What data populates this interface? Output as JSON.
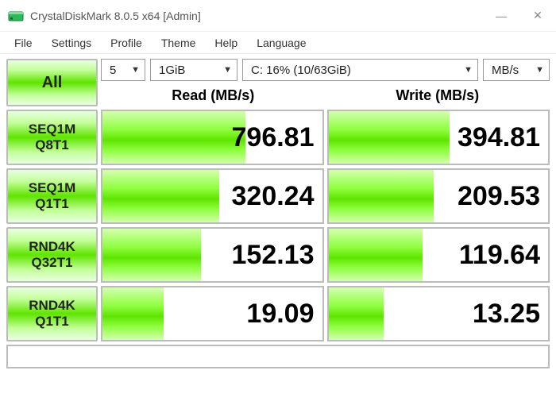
{
  "window": {
    "title": "CrystalDiskMark 8.0.5 x64 [Admin]",
    "minimize": "—",
    "close": "✕"
  },
  "menu": {
    "file": "File",
    "settings": "Settings",
    "profile": "Profile",
    "theme": "Theme",
    "help": "Help",
    "language": "Language"
  },
  "controls": {
    "all_label": "All",
    "runs": "5",
    "size": "1GiB",
    "drive": "C: 16% (10/63GiB)",
    "unit": "MB/s"
  },
  "headers": {
    "read": "Read (MB/s)",
    "write": "Write (MB/s)"
  },
  "tests": [
    {
      "line1": "SEQ1M",
      "line2": "Q8T1",
      "read": "796.81",
      "write": "394.81",
      "read_fill": 65,
      "write_fill": 55
    },
    {
      "line1": "SEQ1M",
      "line2": "Q1T1",
      "read": "320.24",
      "write": "209.53",
      "read_fill": 53,
      "write_fill": 48
    },
    {
      "line1": "RND4K",
      "line2": "Q32T1",
      "read": "152.13",
      "write": "119.64",
      "read_fill": 45,
      "write_fill": 43
    },
    {
      "line1": "RND4K",
      "line2": "Q1T1",
      "read": "19.09",
      "write": "13.25",
      "read_fill": 28,
      "write_fill": 25
    }
  ],
  "chart_data": {
    "type": "table",
    "title": "CrystalDiskMark 8.0.5 x64 — C: 16% (10/63GiB), 1GiB, 5 runs",
    "columns": [
      "Test",
      "Read (MB/s)",
      "Write (MB/s)"
    ],
    "rows": [
      [
        "SEQ1M Q8T1",
        796.81,
        394.81
      ],
      [
        "SEQ1M Q1T1",
        320.24,
        209.53
      ],
      [
        "RND4K Q32T1",
        152.13,
        119.64
      ],
      [
        "RND4K Q1T1",
        19.09,
        13.25
      ]
    ]
  }
}
